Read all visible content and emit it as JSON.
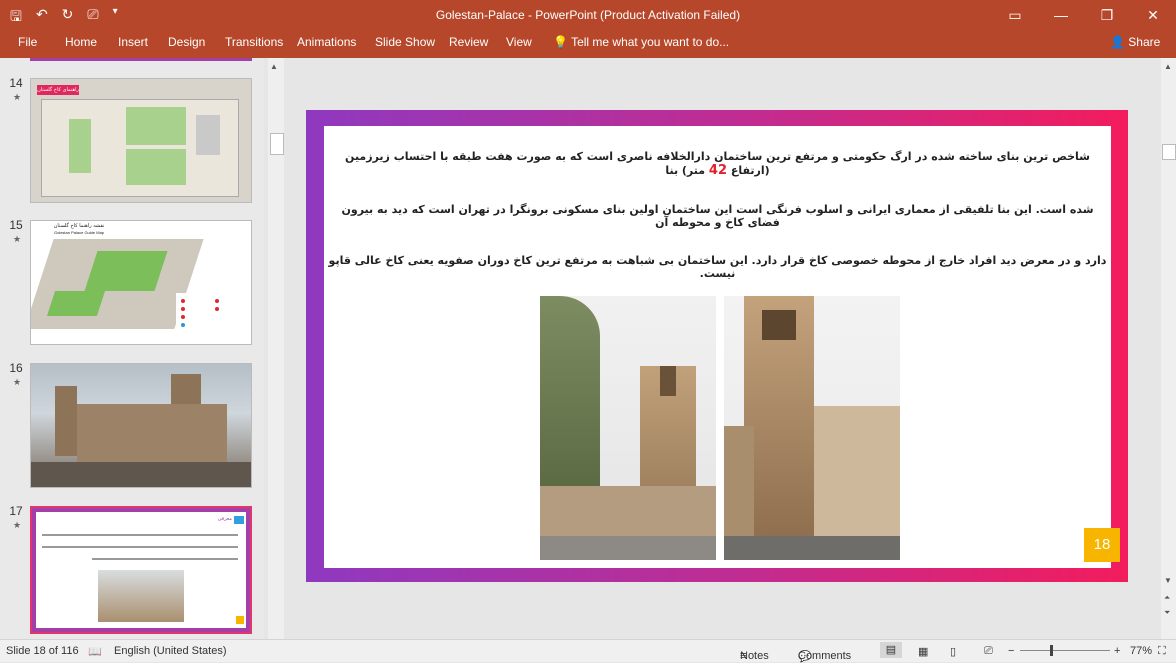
{
  "window": {
    "title": "Golestan-Palace - PowerPoint (Product Activation Failed)",
    "qat_icons": [
      "save-icon",
      "undo-icon",
      "redo-icon",
      "slideshow-icon",
      "customize-icon"
    ]
  },
  "ribbon": {
    "tabs": [
      "File",
      "Home",
      "Insert",
      "Design",
      "Transitions",
      "Animations",
      "Slide Show",
      "Review",
      "View"
    ],
    "tell_me": "Tell me what you want to do...",
    "share": "Share"
  },
  "thumbnails": [
    {
      "number": "14",
      "caption": "راهنمای کاخ گلستان"
    },
    {
      "number": "15",
      "caption": "نقشه راهنما کاخ گلستان",
      "caption2": "Golestan Palace Guide Map"
    },
    {
      "number": "16"
    },
    {
      "number": "17",
      "heading": "معرفی"
    }
  ],
  "slide": {
    "line1_before": "شاخص ترین بنای ساخته شده در ارگ حکومتی و مرتفع ترین ساختمان دارالخلافه ناصری است که به صورت هفت طبقه با احتساب زیرزمین (ارتفاع ",
    "line1_highlight": "42",
    "line1_after": " متر) بنا",
    "line2": "شده است. این بنا تلفیقی از معماری ایرانی و اسلوب فرنگی است این ساختمان اولین بنای مسکونی برونگرا در تهران است که دید به بیرون فضای کاخ و محوطه آن",
    "line3": "دارد و در معرض دید افراد خارج از محوطه خصوصی کاخ قرار دارد. این ساختمان بی شباهت به مرتفع ترین کاخ دوران صفویه یعنی کاخ عالی قاپو نیست.",
    "page_number": "18"
  },
  "status": {
    "slide_info": "Slide 18 of 116",
    "language": "English (United States)",
    "notes": "Notes",
    "comments": "Comments",
    "zoom": "77%"
  },
  "colors": {
    "accent": "#b7472a",
    "selected_thumb": "#e0366d",
    "page_badge": "#f7b500",
    "highlight": "#e21f2b"
  }
}
